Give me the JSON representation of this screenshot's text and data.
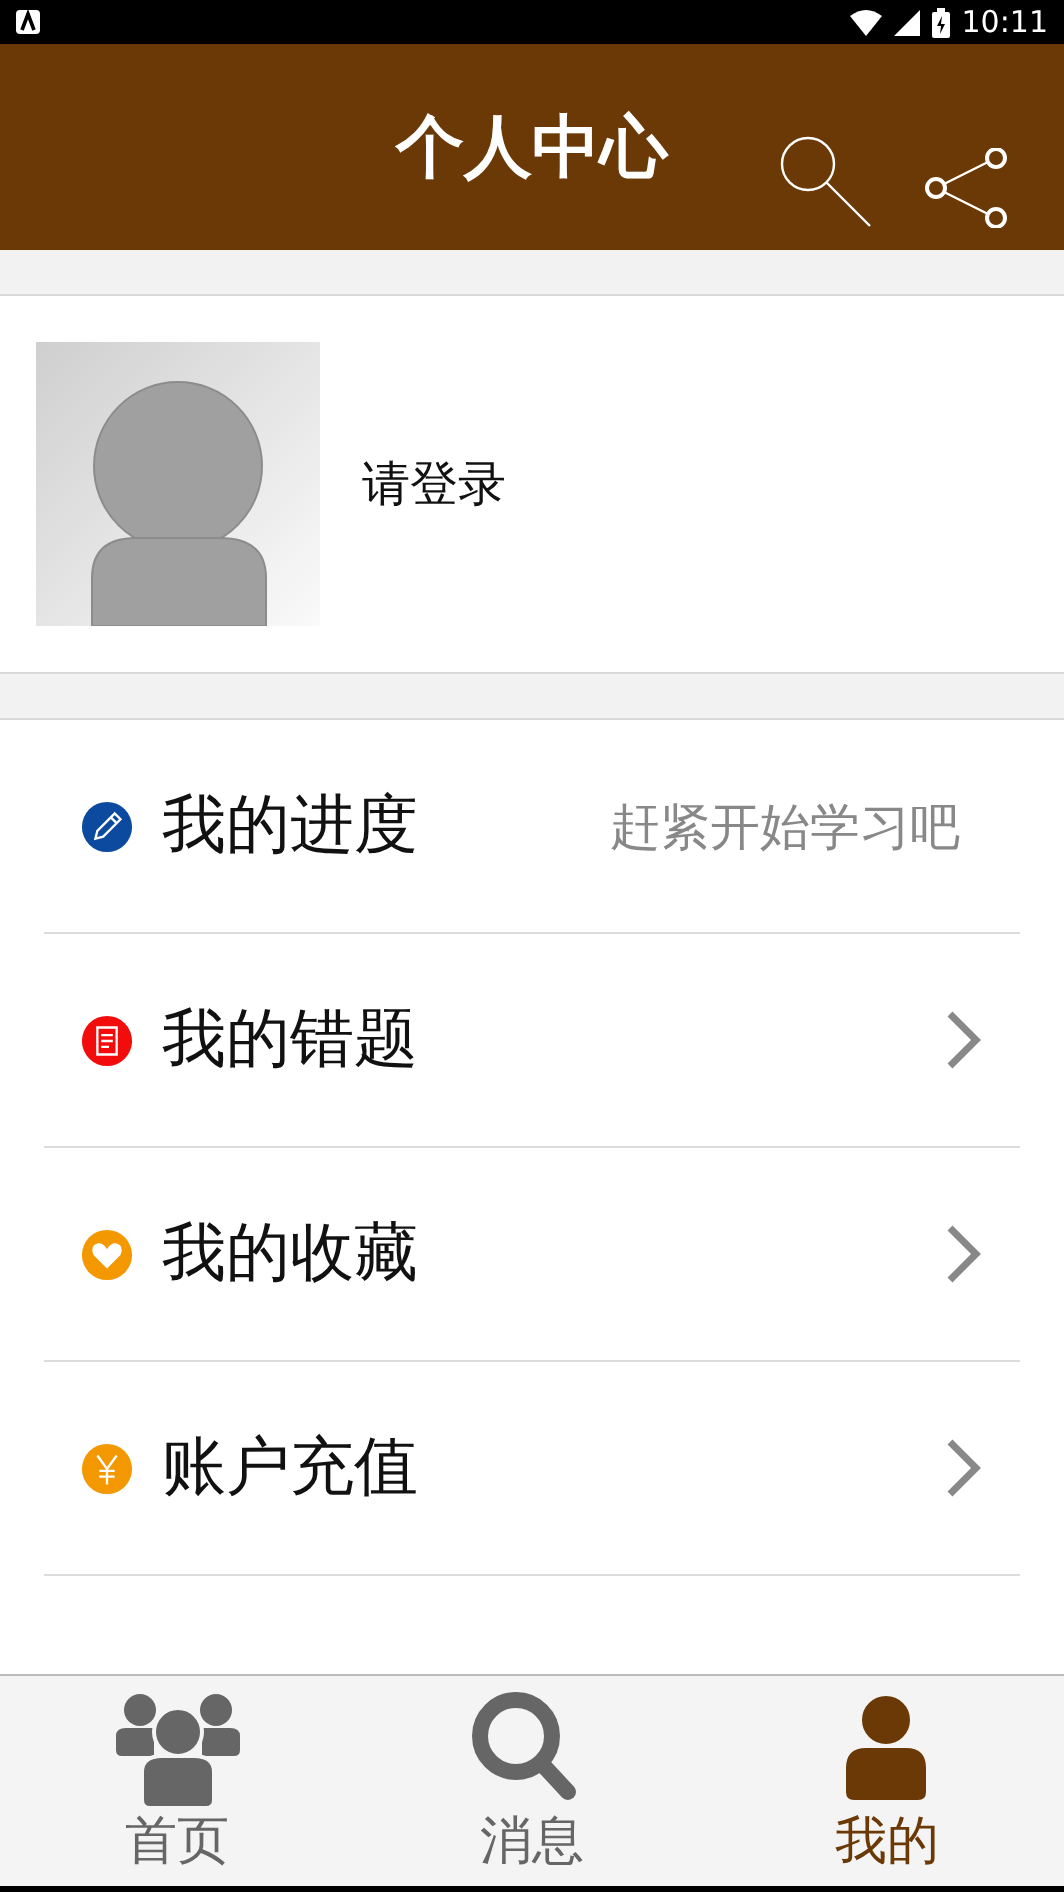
{
  "status_bar": {
    "time": "10:11"
  },
  "header": {
    "title": "个人中心"
  },
  "profile": {
    "login_label": "请登录"
  },
  "menu": [
    {
      "label": "我的进度",
      "kind": "pencil",
      "color": "#0b4a9e",
      "hint": "赶紧开始学习吧"
    },
    {
      "label": "我的错题",
      "kind": "note",
      "color": "#f20c0c"
    },
    {
      "label": "我的收藏",
      "kind": "heart",
      "color": "#f39800"
    },
    {
      "label": "账户充值",
      "kind": "yen",
      "color": "#f39800"
    }
  ],
  "tabs": [
    {
      "label": "首页",
      "kind": "group",
      "selected": false
    },
    {
      "label": "消息",
      "kind": "search",
      "selected": false
    },
    {
      "label": "我的",
      "kind": "person",
      "selected": true
    }
  ]
}
